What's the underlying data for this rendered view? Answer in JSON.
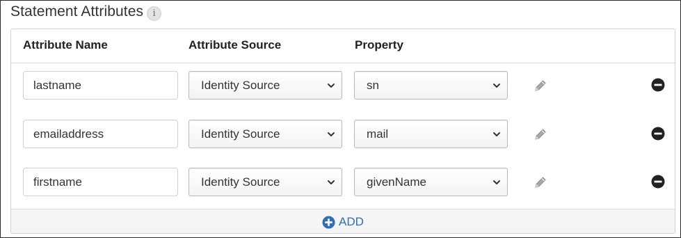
{
  "section": {
    "title": "Statement Attributes",
    "info_glyph": "i"
  },
  "table": {
    "headers": {
      "name": "Attribute Name",
      "source": "Attribute Source",
      "property": "Property"
    },
    "rows": [
      {
        "name": "lastname",
        "source": "Identity Source",
        "property": "sn"
      },
      {
        "name": "emailaddress",
        "source": "Identity Source",
        "property": "mail"
      },
      {
        "name": "firstname",
        "source": "Identity Source",
        "property": "givenName"
      }
    ]
  },
  "footer": {
    "add_label": "ADD"
  },
  "icons": {
    "info": "info-icon",
    "select_caret": "chevron-down-icon",
    "edit": "pencil-icon",
    "remove": "minus-circle-icon",
    "add": "plus-circle-icon"
  },
  "colors": {
    "accent": "#2f6fb5",
    "remove_icon": "#222222",
    "edit_icon": "#9a9a9a"
  }
}
